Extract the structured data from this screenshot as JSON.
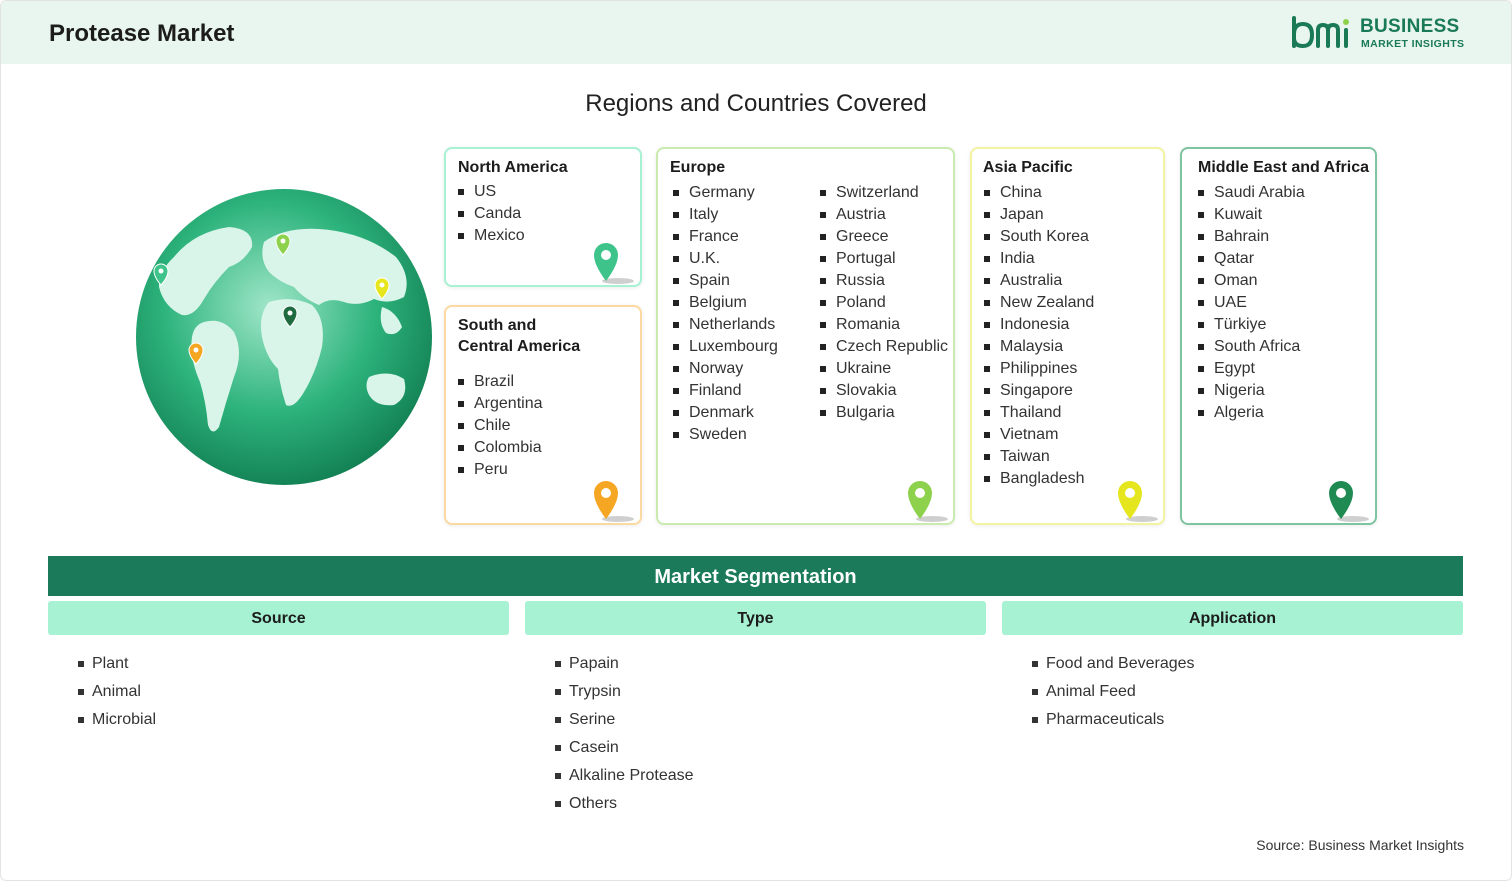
{
  "header": {
    "title": "Protease Market"
  },
  "logo": {
    "word1": "BUSINESS",
    "word2": "MARKET INSIGHTS",
    "color": "#1a7a55"
  },
  "regions_section": {
    "title": "Regions and Countries Covered",
    "regions": [
      {
        "name": "North America",
        "color": "#3ec48a",
        "countries": [
          "US",
          "Canda",
          "Mexico"
        ]
      },
      {
        "name": "South and Central America",
        "color": "#f5a623",
        "countries": [
          "Brazil",
          "Argentina",
          "Chile",
          "Colombia",
          "Peru"
        ]
      },
      {
        "name": "Europe",
        "color": "#8ed14c",
        "countries_col1": [
          "Germany",
          "Italy",
          "France",
          "U.K.",
          "Spain",
          "Belgium",
          "Netherlands",
          "Luxembourg",
          "Norway",
          "Finland",
          "Denmark",
          "Sweden"
        ],
        "countries_col2": [
          "Switzerland",
          "Austria",
          "Greece",
          "Portugal",
          "Russia",
          "Poland",
          "Romania",
          "Czech Republic",
          "Ukraine",
          "Slovakia",
          "Bulgaria"
        ]
      },
      {
        "name": "Asia Pacific",
        "color": "#e6e61e",
        "countries": [
          "China",
          "Japan",
          "South Korea",
          "India",
          "Australia",
          "New Zealand",
          "Indonesia",
          "Malaysia",
          "Philippines",
          "Singapore",
          "Thailand",
          "Vietnam",
          "Taiwan",
          "Bangladesh"
        ]
      },
      {
        "name": "Middle East and Africa",
        "color": "#1f8a52",
        "countries": [
          "Saudi Arabia",
          "Kuwait",
          "Bahrain",
          "Qatar",
          "Oman",
          "UAE",
          "Türkiye",
          "South Africa",
          "Egypt",
          "Nigeria",
          "Algeria"
        ]
      }
    ]
  },
  "segmentation": {
    "title": "Market Segmentation",
    "columns": [
      {
        "header": "Source",
        "items": [
          "Plant",
          "Animal",
          "Microbial"
        ]
      },
      {
        "header": "Type",
        "items": [
          "Papain",
          "Trypsin",
          "Serine",
          "Casein",
          "Alkaline Protease",
          "Others"
        ]
      },
      {
        "header": "Application",
        "items": [
          "Food and Beverages",
          "Animal Feed",
          "Pharmaceuticals"
        ]
      }
    ]
  },
  "footer": {
    "source": "Source: Business Market Insights"
  }
}
